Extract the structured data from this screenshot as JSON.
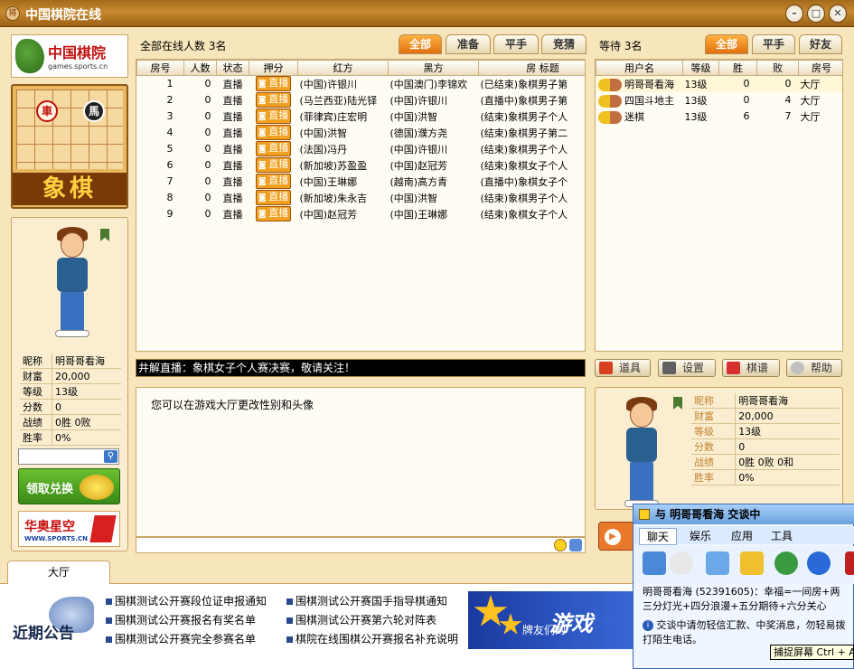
{
  "window": {
    "title": "中国棋院在线",
    "icon_text": "将"
  },
  "logo": {
    "title": "中国棋院",
    "sub": "games.sports.cn"
  },
  "game": {
    "name": "象棋",
    "pieces": [
      "車",
      "馬"
    ]
  },
  "left_profile": {
    "rows": [
      {
        "k": "昵称",
        "v": "明哥哥看海"
      },
      {
        "k": "财富",
        "v": "20,000"
      },
      {
        "k": "等级",
        "v": "13级"
      },
      {
        "k": "分数",
        "v": "0"
      },
      {
        "k": "战绩",
        "v": "0胜 0败"
      },
      {
        "k": "胜率",
        "v": "0%"
      }
    ],
    "exchange_label": "领取兑换",
    "sponsor": {
      "name": "华奥星空",
      "url": "WWW.SPORTS.CN"
    }
  },
  "room_panel": {
    "online_text": "全部在线人数 3名",
    "tabs": [
      "全部",
      "准备",
      "平手",
      "竞猜"
    ],
    "columns": [
      "房号",
      "人数",
      "状态",
      "押分",
      "红方",
      "黑方",
      "房 标题"
    ],
    "rows": [
      {
        "no": "1",
        "count": "0",
        "status": "直播",
        "bet": "直播",
        "red": "(中国)许银川",
        "black": "(中国澳门)李锦欢",
        "title": "(已结束)象棋男子第"
      },
      {
        "no": "2",
        "count": "0",
        "status": "直播",
        "bet": "直播",
        "red": "(马兰西亚)陆光铎",
        "black": "(中国)许银川",
        "title": "(直播中)象棋男子第"
      },
      {
        "no": "3",
        "count": "0",
        "status": "直播",
        "bet": "直播",
        "red": "(菲律宾)庄宏明",
        "black": "(中国)洪智",
        "title": "(结束)象棋男子个人"
      },
      {
        "no": "4",
        "count": "0",
        "status": "直播",
        "bet": "直播",
        "red": "(中国)洪智",
        "black": "(德国)濮方尧",
        "title": "(结束)象棋男子第二"
      },
      {
        "no": "5",
        "count": "0",
        "status": "直播",
        "bet": "直播",
        "red": "(法国)冯丹",
        "black": "(中国)许银川",
        "title": "(结束)象棋男子个人"
      },
      {
        "no": "6",
        "count": "0",
        "status": "直播",
        "bet": "直播",
        "red": "(新加坡)苏盈盈",
        "black": "(中国)赵冠芳",
        "title": "(结束)象棋女子个人"
      },
      {
        "no": "7",
        "count": "0",
        "status": "直播",
        "bet": "直播",
        "red": "(中国)王琳娜",
        "black": "(越南)高方青",
        "title": "(直播中)象棋女子个"
      },
      {
        "no": "8",
        "count": "0",
        "status": "直播",
        "bet": "直播",
        "red": "(新加坡)朱永吉",
        "black": "(中国)洪智",
        "title": "(结束)象棋男子个人"
      },
      {
        "no": "9",
        "count": "0",
        "status": "直播",
        "bet": "直播",
        "red": "(中国)赵冠芳",
        "black": "(中国)王琳娜",
        "title": "(结束)象棋女子个人"
      }
    ]
  },
  "marquee": "井解直播：象棋女子个人赛决赛，敬请关注！",
  "chat_message": "您可以在游戏大厅更改性别和头像",
  "wait_panel": {
    "wait_text": "等待 3名",
    "tabs": [
      "全部",
      "平手",
      "好友"
    ],
    "columns": [
      "用户名",
      "等级",
      "胜",
      "败",
      "房号"
    ],
    "rows": [
      {
        "name": "明哥哥看海",
        "level": "13级",
        "win": "0",
        "lose": "0",
        "room": "大厅"
      },
      {
        "name": "四国斗地主",
        "level": "13级",
        "win": "0",
        "lose": "4",
        "room": "大厅"
      },
      {
        "name": "迷棋",
        "level": "13级",
        "win": "6",
        "lose": "7",
        "room": "大厅"
      }
    ]
  },
  "util_buttons": [
    "道具",
    "设置",
    "棋谱",
    "帮助"
  ],
  "right_profile": {
    "rows": [
      {
        "k": "昵称",
        "v": "明哥哥看海"
      },
      {
        "k": "财富",
        "v": "20,000"
      },
      {
        "k": "等级",
        "v": "13级"
      },
      {
        "k": "分数",
        "v": "0"
      },
      {
        "k": "战绩",
        "v": "0胜 0败 0和"
      },
      {
        "k": "胜率",
        "v": "0%"
      }
    ]
  },
  "bottom": {
    "hall_tab": "大厅",
    "announce": "近期公告",
    "notices": [
      "围棋测试公开赛段位证申报通知",
      "围棋测试公开赛报名有奖名单",
      "围棋测试公开赛完全参赛名单",
      "围棋测试公开赛国手指导棋通知",
      "围棋测试公开赛第六轮对阵表",
      "棋院在线围棋公开赛报名补充说明"
    ],
    "banner_big": "游戏",
    "banner_small": "牌友们的"
  },
  "conversation": {
    "title": "与 明哥哥看海 交谈中",
    "menu": [
      "聊天",
      "娱乐",
      "应用",
      "工具"
    ],
    "msg_line1": "明哥哥看海 (52391605)：幸福=一间房+两",
    "msg_line2": "三分灯光+四分浪漫+五分期待+六分关心",
    "warn": "交谈中请勿轻信汇款、中奖消息，勿轻易拨打陌生电话。",
    "capture_tip": "捕捉屏幕 Ctrl + Alt + A"
  }
}
